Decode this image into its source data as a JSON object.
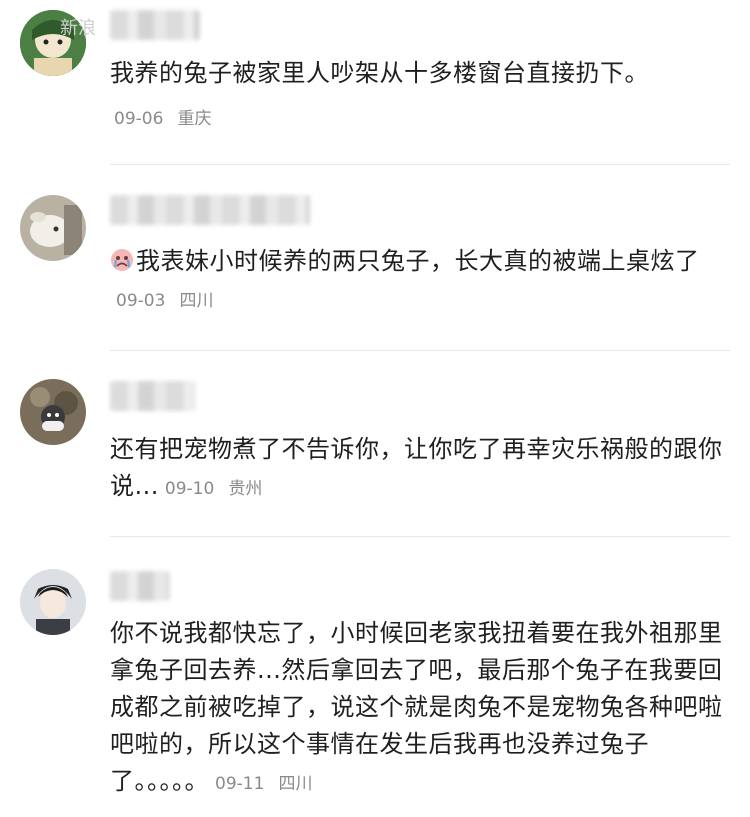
{
  "watermark": "新浪",
  "comments": [
    {
      "text": "我养的兔子被家里人吵架从十多楼窗台直接扔下。",
      "date": "09-06",
      "location": "重庆"
    },
    {
      "emoji_icon": "crying-face-icon",
      "text": "我表妹小时候养的两只兔子，长大真的被端上桌炫了",
      "date": "09-03",
      "location": "四川"
    },
    {
      "text": "还有把宠物煮了不告诉你，让你吃了再幸灾乐祸般的跟你说...",
      "date": "09-10",
      "location": "贵州"
    },
    {
      "text": "你不说我都快忘了，小时候回老家我扭着要在我外祖那里拿兔子回去养...然后拿回去了吧，最后那个兔子在我要回成都之前被吃掉了，说这个就是肉兔不是宠物兔各种吧啦吧啦的，所以这个事情在发生后我再也没养过兔子了。。。。。",
      "date": "09-11",
      "location": "四川"
    }
  ]
}
